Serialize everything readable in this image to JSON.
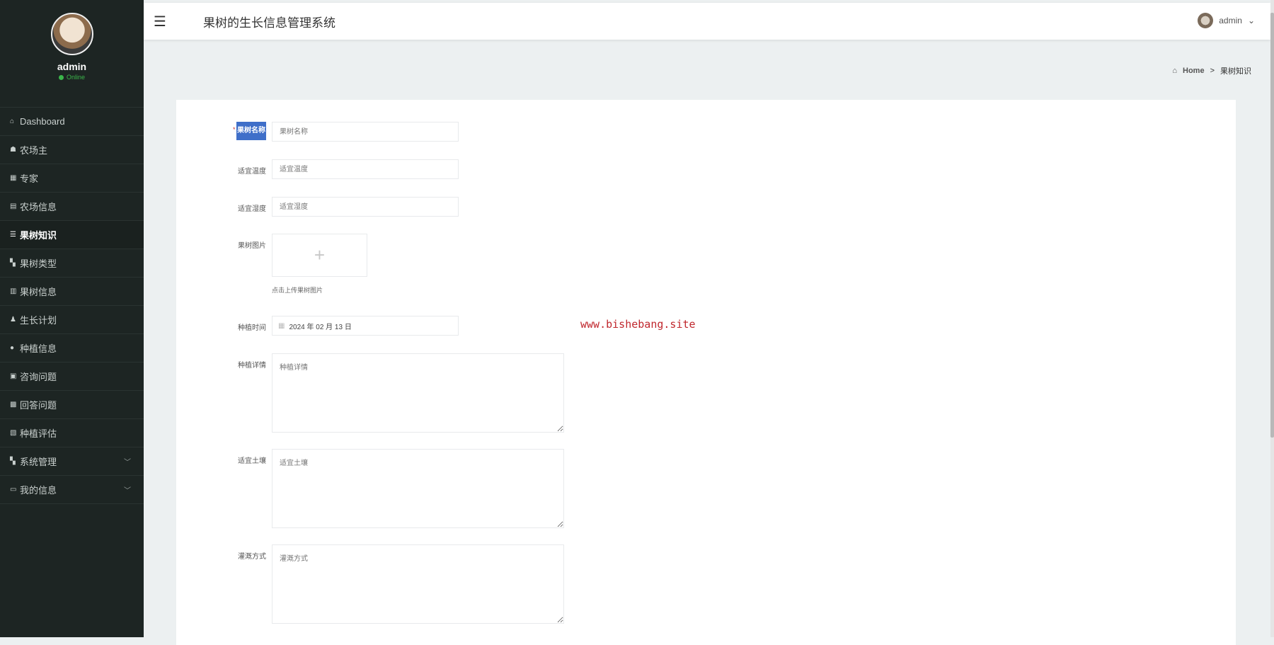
{
  "profile": {
    "name": "admin",
    "status": "Online"
  },
  "menu": [
    {
      "icon": "⌂",
      "label": "Dashboard",
      "name": "sidebar-item-dashboard"
    },
    {
      "icon": "☗",
      "label": "农场主",
      "name": "sidebar-item-farm-owner"
    },
    {
      "icon": "▦",
      "label": "专家",
      "name": "sidebar-item-expert"
    },
    {
      "icon": "▤",
      "label": "农场信息",
      "name": "sidebar-item-farm-info"
    },
    {
      "icon": "☰",
      "label": "果树知识",
      "name": "sidebar-item-fruit-knowledge"
    },
    {
      "icon": "▚",
      "label": "果树类型",
      "name": "sidebar-item-fruit-type"
    },
    {
      "icon": "▥",
      "label": "果树信息",
      "name": "sidebar-item-fruit-info"
    },
    {
      "icon": "♟",
      "label": "生长计划",
      "name": "sidebar-item-growth-plan"
    },
    {
      "icon": "●",
      "label": "种植信息",
      "name": "sidebar-item-planting-info"
    },
    {
      "icon": "▣",
      "label": "咨询问题",
      "name": "sidebar-item-consult"
    },
    {
      "icon": "▩",
      "label": "回答问题",
      "name": "sidebar-item-answer"
    },
    {
      "icon": "▧",
      "label": "种植评估",
      "name": "sidebar-item-evaluation"
    },
    {
      "icon": "▚",
      "label": "系统管理",
      "name": "sidebar-item-system",
      "chevron": "﹀"
    },
    {
      "icon": "▭",
      "label": "我的信息",
      "name": "sidebar-item-my-info",
      "chevron": "﹀"
    }
  ],
  "header": {
    "menu_icon": "☰",
    "title": "果树的生长信息管理系统",
    "user": "admin",
    "user_chevron": "⌄"
  },
  "breadcrumb": {
    "home": "Home",
    "sep": ">",
    "current": "果树知识"
  },
  "form": {
    "name_label": "果树名称",
    "name_placeholder": "果树名称",
    "required_mark": "*",
    "temp_label": "适宜温度",
    "temp_placeholder": "适宜温度",
    "humid_label": "适宜湿度",
    "humid_placeholder": "适宜湿度",
    "image_label": "果树图片",
    "upload_plus": "+",
    "upload_hint": "点击上传果树图片",
    "time_label": "种植时间",
    "time_value": "2024 年 02 月 13 日",
    "detail_label": "种植详情",
    "detail_placeholder": "种植详情",
    "soil_label": "适宜土壤",
    "soil_placeholder": "适宜土壤",
    "irrig_label": "灌溉方式",
    "irrig_placeholder": "灌溉方式"
  },
  "watermark": "www.bishebang.site"
}
